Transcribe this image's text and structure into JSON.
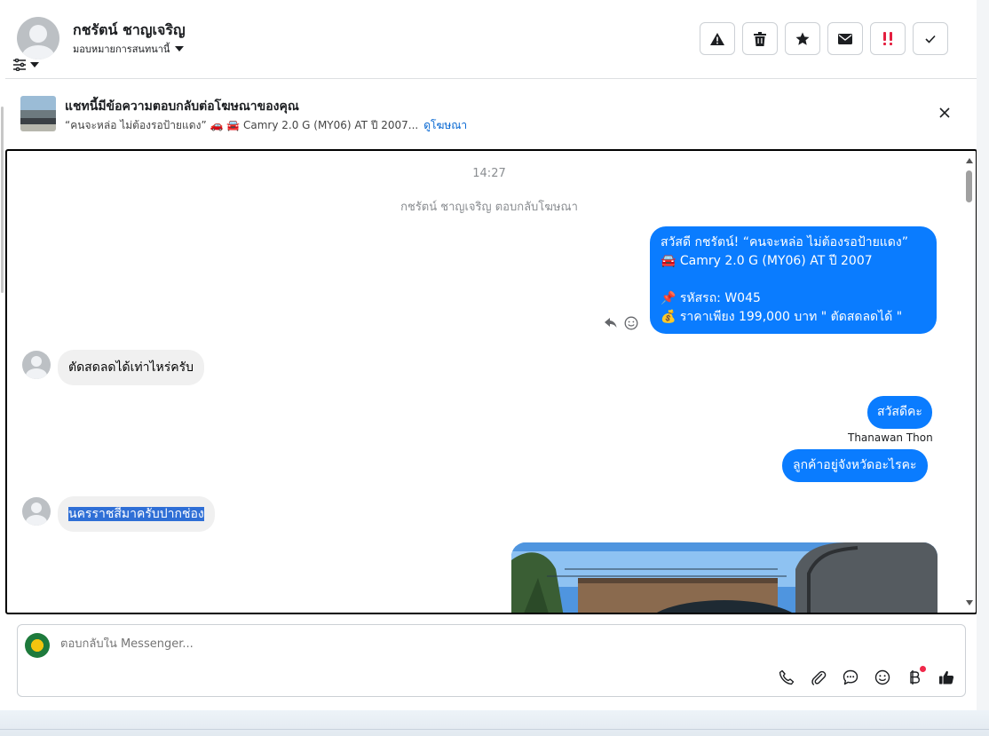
{
  "header": {
    "contact_name": "กชรัตน์ ชาญเจริญ",
    "assign_label": "มอบหมายการสนทนานี้",
    "actions": [
      {
        "name": "spam-button",
        "icon": "warning-icon"
      },
      {
        "name": "delete-button",
        "icon": "trash-icon"
      },
      {
        "name": "star-button",
        "icon": "star-icon"
      },
      {
        "name": "mark-unread-button",
        "icon": "envelope-icon"
      },
      {
        "name": "follow-up-button",
        "icon": "double-exclamation-icon",
        "color": "#e41e3f"
      },
      {
        "name": "mark-done-button",
        "icon": "checkmark-icon"
      }
    ]
  },
  "ad_banner": {
    "title": "แชทนี้มีข้อความตอบกลับต่อโฆษณาของคุณ",
    "subtitle": "“คนจะหล่อ ไม่ต้องรอป้ายแดง” 🚗 🚘 Camry 2.0 G (MY06) AT ปี 2007...",
    "link": "ดูโฆษณา"
  },
  "chat": {
    "timestamp": "14:27",
    "system_note": "กชรัตน์ ชาญเจริญ ตอบกลับโฆษณา",
    "ad_message": "สวัสดี กชรัตน์! “คนจะหล่อ ไม่ต้องรอป้ายแดง”\n🚘 Camry 2.0 G (MY06) AT ปี 2007\n\n📌 รหัสรถ: W045\n💰 ราคาเพียง 199,000 บาท \" ตัดสดลดได้ \"",
    "incoming_1": "ตัดสดลดได้เท่าไหร่ครับ",
    "outgoing_1": "สวัสดีคะ",
    "sender_label": "Thanawan Thon",
    "outgoing_2": "ลูกค้าอยู่จังหวัดอะไรคะ",
    "incoming_2": "นครราชสีมาครับปากช่อง"
  },
  "composer": {
    "placeholder": "ตอบกลับใน Messenger...",
    "tools": [
      "phone-icon",
      "paperclip-icon",
      "chat-bubble-icon",
      "emoji-icon",
      "baht-icon",
      "thumbs-up-icon"
    ]
  },
  "colors": {
    "accent": "#0a7cff",
    "link": "#0064d1",
    "alert": "#e41e3f"
  }
}
